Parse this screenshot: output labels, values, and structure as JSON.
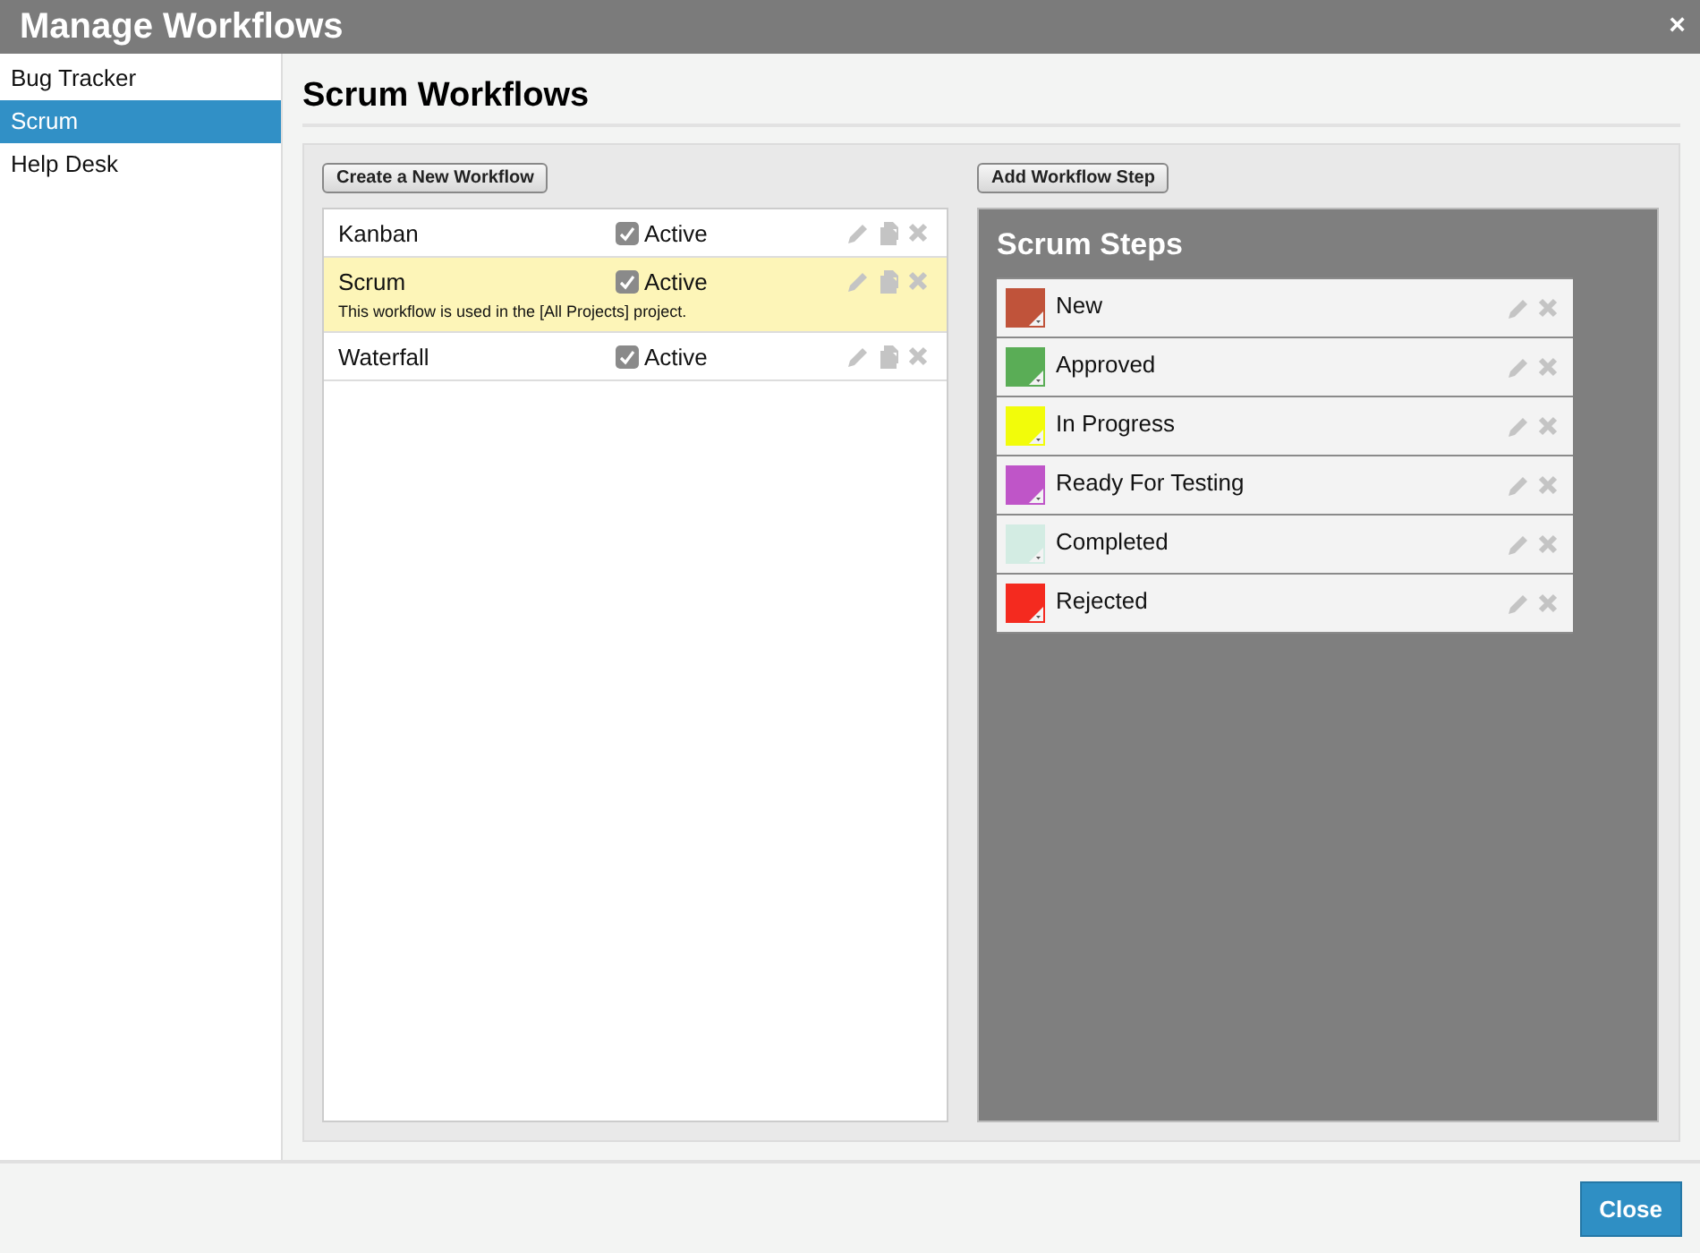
{
  "window": {
    "title": "Manage Workflows",
    "close": "×"
  },
  "sidebar": {
    "items": [
      {
        "label": "Bug Tracker",
        "selected": false
      },
      {
        "label": "Scrum",
        "selected": true
      },
      {
        "label": "Help Desk",
        "selected": false
      }
    ]
  },
  "heading": "Scrum Workflows",
  "create_button": "Create a New Workflow",
  "workflows": [
    {
      "name": "Kanban",
      "active": true,
      "active_label": "Active",
      "selected": false
    },
    {
      "name": "Scrum",
      "active": true,
      "active_label": "Active",
      "selected": true,
      "note": "This workflow is used in the [All Projects] project."
    },
    {
      "name": "Waterfall",
      "active": true,
      "active_label": "Active",
      "selected": false
    }
  ],
  "add_step_button": "Add Workflow Step",
  "steps_title": "Scrum Steps",
  "steps": [
    {
      "name": "New",
      "color": "#c0533a"
    },
    {
      "name": "Approved",
      "color": "#5aad56"
    },
    {
      "name": "In Progress",
      "color": "#f2fc0a"
    },
    {
      "name": "Ready For Testing",
      "color": "#bf55c8"
    },
    {
      "name": "Completed",
      "color": "#d3ece3"
    },
    {
      "name": "Rejected",
      "color": "#f42a1f"
    }
  ],
  "footer": {
    "close_button": "Close"
  }
}
